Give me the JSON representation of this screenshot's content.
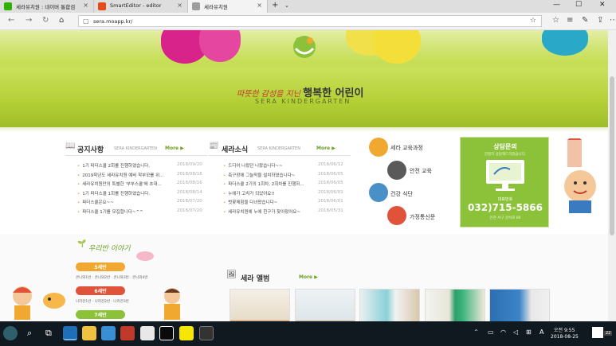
{
  "browser": {
    "tabs": [
      {
        "label": "세라유치원 : 네이버 통합검",
        "color": "#2db400"
      },
      {
        "label": "SmartEditor - editor",
        "color": "#e64a19"
      },
      {
        "label": "세라유치원",
        "color": "#9e9e9e"
      }
    ],
    "new_tab": "+",
    "url": "sera.moapp.kr/"
  },
  "hero": {
    "slogan_small": "따뜻한 감성을 지닌",
    "slogan_big": "행복한 어린이",
    "subtitle": "SERA KINDERGARTEN"
  },
  "notice": {
    "title": "공지사항",
    "sub": "SERA KINDERGARTEN",
    "more": "More ▶",
    "items": [
      {
        "text": "1기 파더스쿨 2회를 진행하였습니다.",
        "date": "2018/09/20"
      },
      {
        "text": "2019학년도 세라유치원 예비 학부모를 위...",
        "date": "2018/08/16"
      },
      {
        "text": "세라유치원만의 특별한 '부부스쿨'에 초대...",
        "date": "2018/08/16"
      },
      {
        "text": "1기 파더스쿨 1회를 진행하였습니다.",
        "date": "2018/08/14"
      },
      {
        "text": "파더스쿨은요~~",
        "date": "2018/07/20"
      },
      {
        "text": "파더스쿨 1기를 모집합니다~^^",
        "date": "2018/07/20"
      }
    ]
  },
  "news": {
    "title": "세라소식",
    "sub": "SERA KINDERGARTEN",
    "more": "More ▶",
    "items": [
      {
        "text": "드디어 나왔던 나왔습니다~~",
        "date": "2018/06/12"
      },
      {
        "text": "축구장에 그늘막을 설치하였습니다~",
        "date": "2018/06/05"
      },
      {
        "text": "파더스쿨 2기의 1회차, 2회차를 진행하...",
        "date": "2018/06/05"
      },
      {
        "text": "누에가 고치가 되었어요!!",
        "date": "2018/06/01"
      },
      {
        "text": "벗꽃체험을 다녀왔습니다~",
        "date": "2018/06/01"
      },
      {
        "text": "세라유치원에 누에 친구가 찾아왔어요~",
        "date": "2018/05/31"
      }
    ]
  },
  "categories": [
    {
      "label": "세라 교육과정",
      "color": "#f0a830"
    },
    {
      "label": "안전 교육",
      "color": "#5a5a5a"
    },
    {
      "label": "건강 식단",
      "color": "#4a90c8"
    },
    {
      "label": "가정통신문",
      "color": "#e0523a"
    }
  ],
  "consult": {
    "title": "상담문의",
    "sub": "친절히 상담해드리겠습니다.",
    "phone_label": "대표번호",
    "phone": "032)715-5866",
    "addr": "인천 서구 검석로 80"
  },
  "kids": {
    "title": "우리반 이야기",
    "classes": [
      {
        "label": "5세반",
        "color": "#f0a830",
        "list": "콘니와1반 · 콘니와2반 · 콘니와3반 · 콘니와4반"
      },
      {
        "label": "6세반",
        "color": "#e0523a",
        "list": "나라잔1반 · 나라잔2반 · 나라잔3반"
      },
      {
        "label": "7세반",
        "color": "#8bc23a",
        "list": ""
      }
    ]
  },
  "album": {
    "title": "세라 앨범",
    "more": "More ▶"
  },
  "taskbar": {
    "time": "오전 9:55",
    "date": "2018-08-25",
    "lang": "A",
    "badge": "22"
  }
}
